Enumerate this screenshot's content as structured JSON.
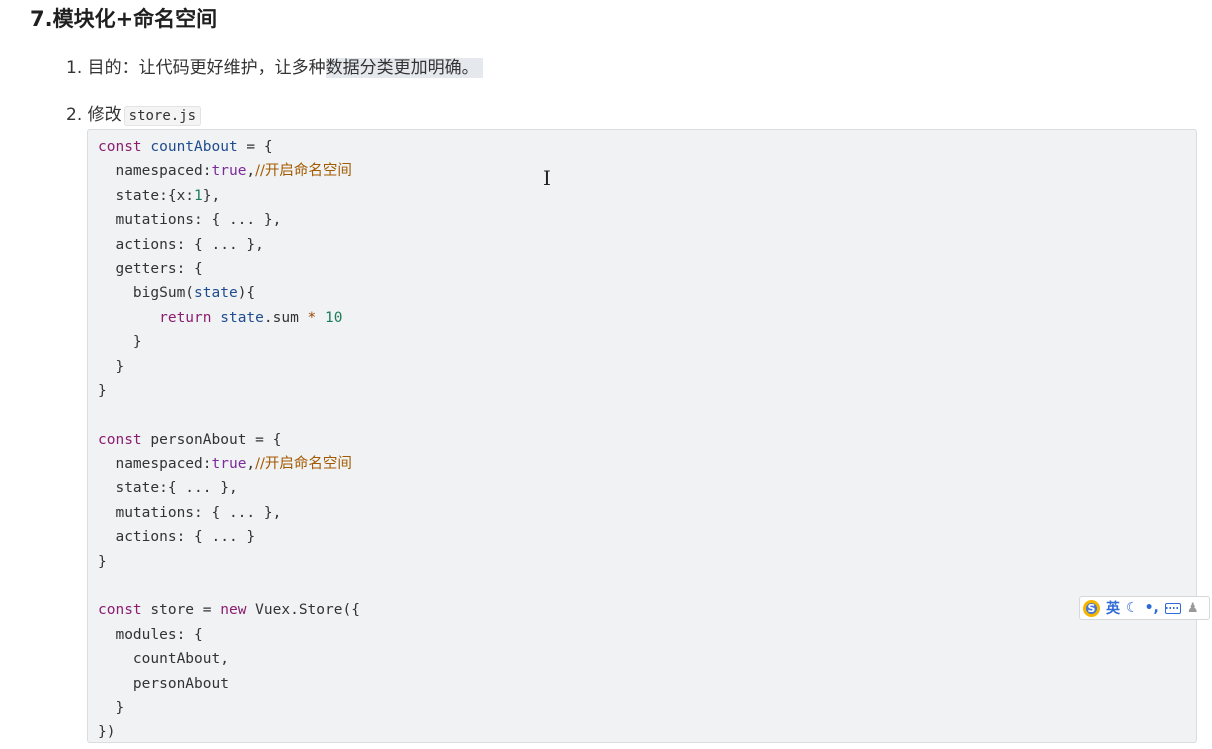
{
  "heading": "7.模块化+命名空间",
  "list": {
    "item1": {
      "number": "1.",
      "text_plain": "目的：让代码更好维护，让多种",
      "text_highlighted": "数据分类更加明确。"
    },
    "item2": {
      "number": "2.",
      "text": "修改",
      "code": "store.js"
    }
  },
  "code_tokens": {
    "const": "const",
    "countAbout": "countAbout",
    "personAbout": "personAbout",
    "store": "store",
    "eq_brace": " = {",
    "namespaced": "  namespaced:",
    "true": "true",
    "comma": ",",
    "comment_namespace": "//开启命名空间",
    "state_x_pre": "  state:{x:",
    "state_x_num": "1",
    "state_x_post": "},",
    "mutations_ellipsis": "  mutations: { ... },",
    "actions_ellipsis_comma": "  actions: { ... },",
    "getters_open": "  getters: {",
    "bigSum_pre": "    bigSum(",
    "state_word": "state",
    "bigSum_post": "){",
    "return_indent": "       ",
    "return": "return",
    "sum_expr": ".sum ",
    "times": "*",
    "ten": "10",
    "close_4": "    }",
    "close_2": "  }",
    "close_0": "}",
    "state_ellipsis": "  state:{ ... },",
    "actions_ellipsis": "  actions: { ... }",
    "store_eq": " = ",
    "new": "new",
    "vuex_store": " Vuex.Store({",
    "modules_open": "  modules: {",
    "module_countAbout": "    countAbout,",
    "module_personAbout": "    personAbout",
    "final_close": "})"
  },
  "ime_toolbar": {
    "logo": "S",
    "language": "英",
    "moon_icon": "moon-icon",
    "punct": "•,",
    "keyboard_icon": "keyboard-icon",
    "user_icon": "user-icon"
  },
  "colors": {
    "keyword": "#8a1d70",
    "definition": "#1f4c8f",
    "comment": "#a25a00",
    "number": "#1b7d5a",
    "code_background": "#f1f2f3"
  }
}
